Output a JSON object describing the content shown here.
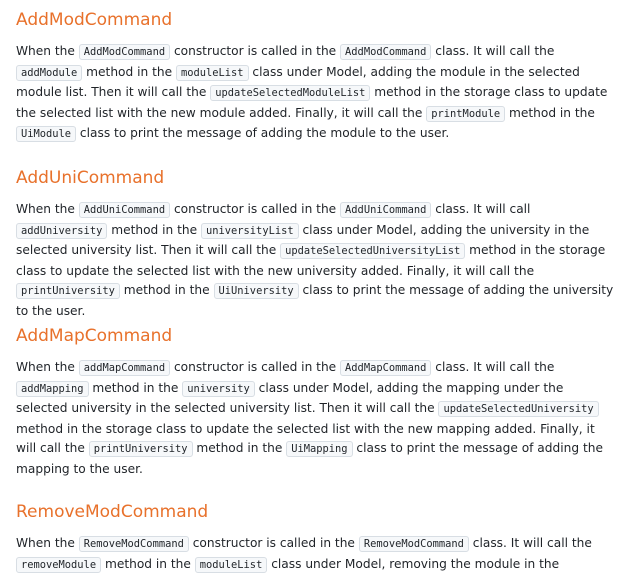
{
  "sections": [
    {
      "title": "AddModCommand",
      "segments": [
        {
          "t": "When the "
        },
        {
          "c": "AddModCommand"
        },
        {
          "t": " constructor is called in the "
        },
        {
          "c": "AddModCommand"
        },
        {
          "t": " class. It will call the "
        },
        {
          "c": "addModule"
        },
        {
          "t": " method in the "
        },
        {
          "c": "moduleList"
        },
        {
          "t": " class under Model, adding the module in the selected module list. Then it will call the "
        },
        {
          "c": "updateSelectedModuleList"
        },
        {
          "t": " method in the storage class to update the selected list with the new module added. Finally, it will call the "
        },
        {
          "c": "printModule"
        },
        {
          "t": " method in the "
        },
        {
          "c": "UiModule"
        },
        {
          "t": " class to print the message of adding the module to the user."
        }
      ]
    },
    {
      "title": "AddUniCommand",
      "segments": [
        {
          "t": "When the "
        },
        {
          "c": "AddUniCommand"
        },
        {
          "t": " constructor is called in the "
        },
        {
          "c": "AddUniCommand"
        },
        {
          "t": " class. It will call "
        },
        {
          "c": "addUniversity"
        },
        {
          "t": " method in the "
        },
        {
          "c": "universityList"
        },
        {
          "t": " class under Model, adding the university in the selected university list. Then it will call the "
        },
        {
          "c": "updateSelectedUniversityList"
        },
        {
          "t": " method in the storage class to update the selected list with the new university added. Finally, it will call the "
        },
        {
          "c": "printUniversity"
        },
        {
          "t": " method in the "
        },
        {
          "c": "UiUniversity"
        },
        {
          "t": " class to print the message of adding the university to the user."
        }
      ]
    },
    {
      "title": "AddMapCommand",
      "segments": [
        {
          "t": "When the "
        },
        {
          "c": "addMapCommand"
        },
        {
          "t": " constructor is called in the "
        },
        {
          "c": "AddMapCommand"
        },
        {
          "t": " class. It will call the "
        },
        {
          "c": "addMapping"
        },
        {
          "t": " method in the "
        },
        {
          "c": "university"
        },
        {
          "t": " class under Model, adding the mapping under the selected university in the selected university list. Then it will call the "
        },
        {
          "c": "updateSelectedUniversity"
        },
        {
          "t": " method in the storage class to update the selected list with the new mapping added. Finally, it will call the "
        },
        {
          "c": "printUniversity"
        },
        {
          "t": " method in the "
        },
        {
          "c": "UiMapping"
        },
        {
          "t": " class to print the message of adding the mapping to the user."
        }
      ]
    },
    {
      "title": "RemoveModCommand",
      "segments": [
        {
          "t": "When the "
        },
        {
          "c": "RemoveModCommand"
        },
        {
          "t": " constructor is called in the "
        },
        {
          "c": "RemoveModCommand"
        },
        {
          "t": " class. It will call the "
        },
        {
          "c": "removeModule"
        },
        {
          "t": " method in the "
        },
        {
          "c": "moduleList"
        },
        {
          "t": " class under Model, removing the module in the selected"
        }
      ]
    }
  ]
}
